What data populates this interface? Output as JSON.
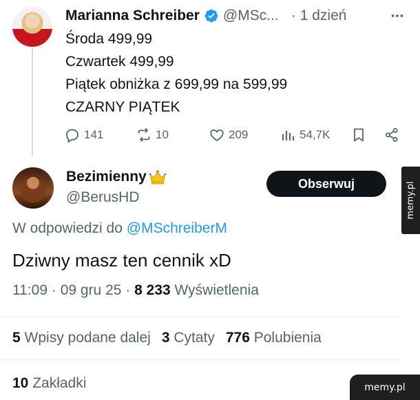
{
  "tweet1": {
    "display_name": "Marianna Schreiber",
    "handle": "@MSc...",
    "dot": "·",
    "time": "1 dzień",
    "lines": [
      "Środa 499,99",
      "Czwartek 499,99",
      "Piątek obniżka z 699,99 na 599,99",
      "CZARNY PIĄTEK"
    ],
    "actions": {
      "replies": "141",
      "reposts": "10",
      "likes": "209",
      "views": "54,7K"
    },
    "verified_color": "#1d9bf0"
  },
  "tweet2": {
    "display_name": "Bezimienny",
    "handle": "@BerusHD",
    "follow_label": "Obserwuj",
    "reply_prefix": "W odpowiedzi do ",
    "reply_handle": "@MSchreiberM",
    "text": "Dziwny masz ten cennik xD",
    "time": "11:09",
    "date": "09 gru 25",
    "views_count": "8 233",
    "views_label": "Wyświetlenia",
    "sep": "·",
    "stats": {
      "reposts_count": "5",
      "reposts_label": "Wpisy podane dalej",
      "quotes_count": "3",
      "quotes_label": "Cytaty",
      "likes_count": "776",
      "likes_label": "Polubienia",
      "bookmarks_count": "10",
      "bookmarks_label": "Zakładki"
    }
  },
  "watermarks": {
    "side": "memy.pl",
    "corner": "memy.pl"
  },
  "colors": {
    "accent": "#1d9bf0",
    "text": "#0f1419",
    "secondary": "#536471",
    "follow_bg": "#0f1419"
  },
  "icons": [
    "verified-badge-icon",
    "more-icon",
    "reply-icon",
    "repost-icon",
    "like-icon",
    "views-icon",
    "bookmark-icon",
    "share-icon",
    "crown-icon"
  ]
}
